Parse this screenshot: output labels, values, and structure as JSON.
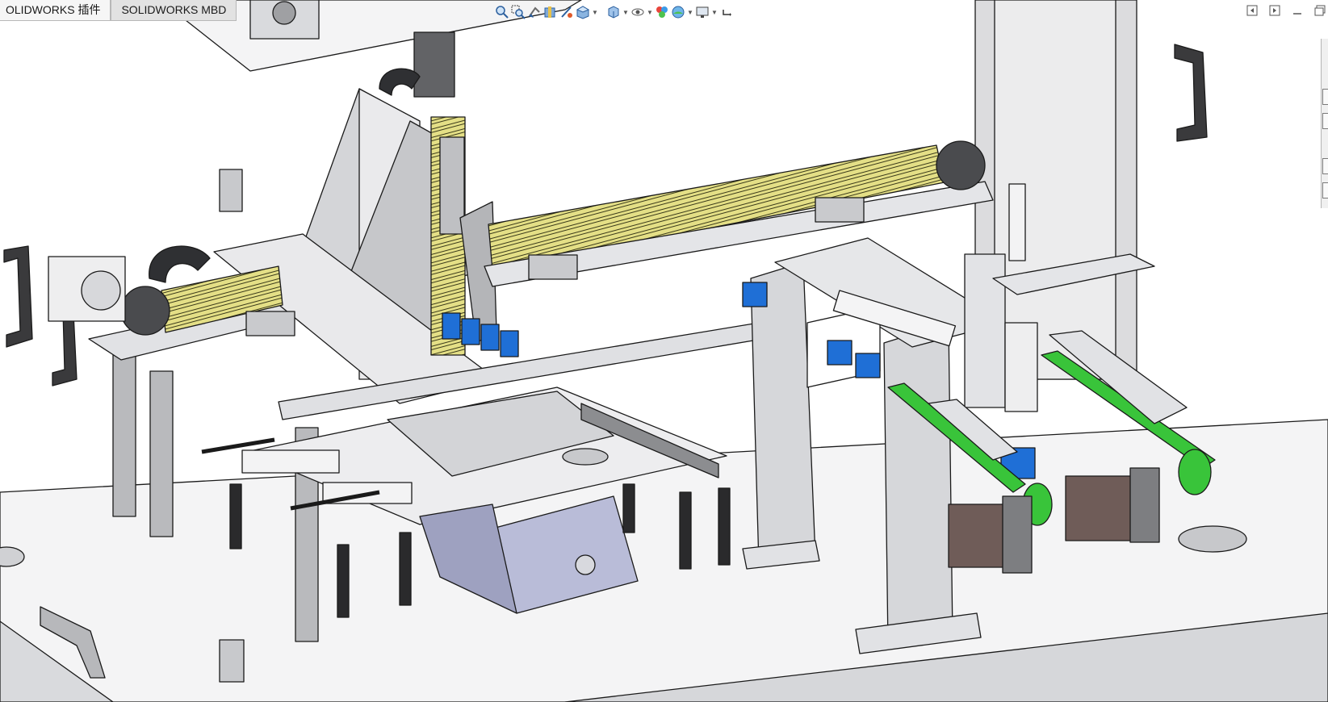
{
  "command_tabs": [
    {
      "label": "OLIDWORKS 插件"
    },
    {
      "label": "SOLIDWORKS MBD"
    }
  ],
  "heads_up_toolbar": {
    "icons": [
      "zoom-to-fit-icon",
      "zoom-to-area-icon",
      "previous-view-icon",
      "section-view-icon",
      "dynamic-annotation-icon",
      "view-orientation-icon",
      "display-style-icon",
      "hide-show-items-icon",
      "edit-appearance-icon",
      "apply-scene-icon",
      "view-settings-icon",
      "rotate-icon"
    ]
  },
  "window_controls": {
    "icons": [
      "restore-left-icon",
      "restore-right-icon",
      "minimize-icon",
      "maximize-icon"
    ]
  },
  "colors": {
    "background": "#ffffff",
    "part_gray": "#c8c9cc",
    "part_light": "#dfe0e3",
    "edge": "#1a1a1a",
    "linear_module_yellow": "#ddd77a",
    "sensor_blue": "#1f6fd6",
    "belt_green": "#39c43a",
    "motor_brown": "#6f5c58",
    "enclosure_lavender": "#b9bcd8"
  }
}
